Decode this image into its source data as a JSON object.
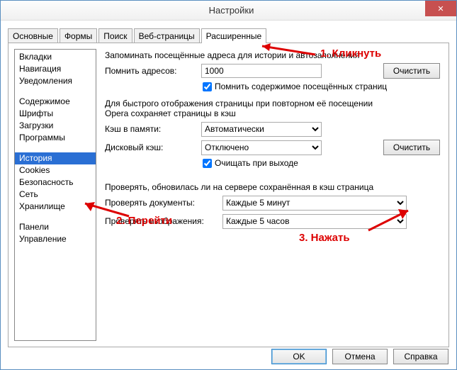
{
  "window": {
    "title": "Настройки"
  },
  "tabs": [
    "Основные",
    "Формы",
    "Поиск",
    "Веб-страницы",
    "Расширенные"
  ],
  "activeTab": 4,
  "sidebar": {
    "groups": [
      [
        "Вкладки",
        "Навигация",
        "Уведомления"
      ],
      [
        "Содержимое",
        "Шрифты",
        "Загрузки",
        "Программы"
      ],
      [
        "История",
        "Cookies",
        "Безопасность",
        "Сеть",
        "Хранилище"
      ],
      [
        "Панели",
        "Управление"
      ]
    ],
    "selected": "История"
  },
  "main": {
    "heading": "Запоминать посещённые адреса для истории и автозаполнения",
    "remember_label": "Помнить адресов:",
    "remember_value": "1000",
    "clear1": "Очистить",
    "remember_content": "Помнить содержимое посещённых страниц",
    "cache_desc1": "Для быстрого отображения страницы при повторном её посещении",
    "cache_desc2": "Opera сохраняет страницы в кэш",
    "memcache_label": "Кэш в памяти:",
    "memcache_value": "Автоматически",
    "diskcache_label": "Дисковый кэш:",
    "diskcache_value": "Отключено",
    "clear2": "Очистить",
    "clear_on_exit": "Очищать при выходе",
    "check_heading": "Проверять, обновилась ли на сервере сохранённая в кэш страница",
    "check_docs_label": "Проверять документы:",
    "check_docs_value": "Каждые 5 минут",
    "check_imgs_label": "Проверять изображения:",
    "check_imgs_value": "Каждые 5 часов"
  },
  "annotations": {
    "a1": "1. Кликнуть",
    "a2": "2. Перейти",
    "a3": "3. Нажать"
  },
  "buttons": {
    "ok": "OK",
    "cancel": "Отмена",
    "help": "Справка"
  }
}
